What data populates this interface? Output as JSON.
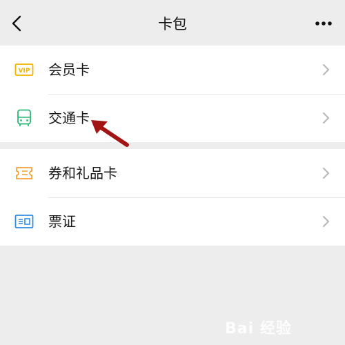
{
  "nav": {
    "title": "卡包",
    "back_icon": "chevron-left-icon",
    "more_icon": "more-dots-icon"
  },
  "groups": [
    {
      "items": [
        {
          "label": "会员卡",
          "icon": "vip-card-icon",
          "icon_color": "#f0b400"
        },
        {
          "label": "交通卡",
          "icon": "bus-icon",
          "icon_color": "#2bb673"
        }
      ]
    },
    {
      "items": [
        {
          "label": "券和礼品卡",
          "icon": "ticket-icon",
          "icon_color": "#f3a13a"
        },
        {
          "label": "票证",
          "icon": "id-card-icon",
          "icon_color": "#2f8ce4"
        }
      ]
    }
  ],
  "annotation": {
    "color": "#a31515"
  },
  "watermark": {
    "text": "Bai 经验"
  }
}
